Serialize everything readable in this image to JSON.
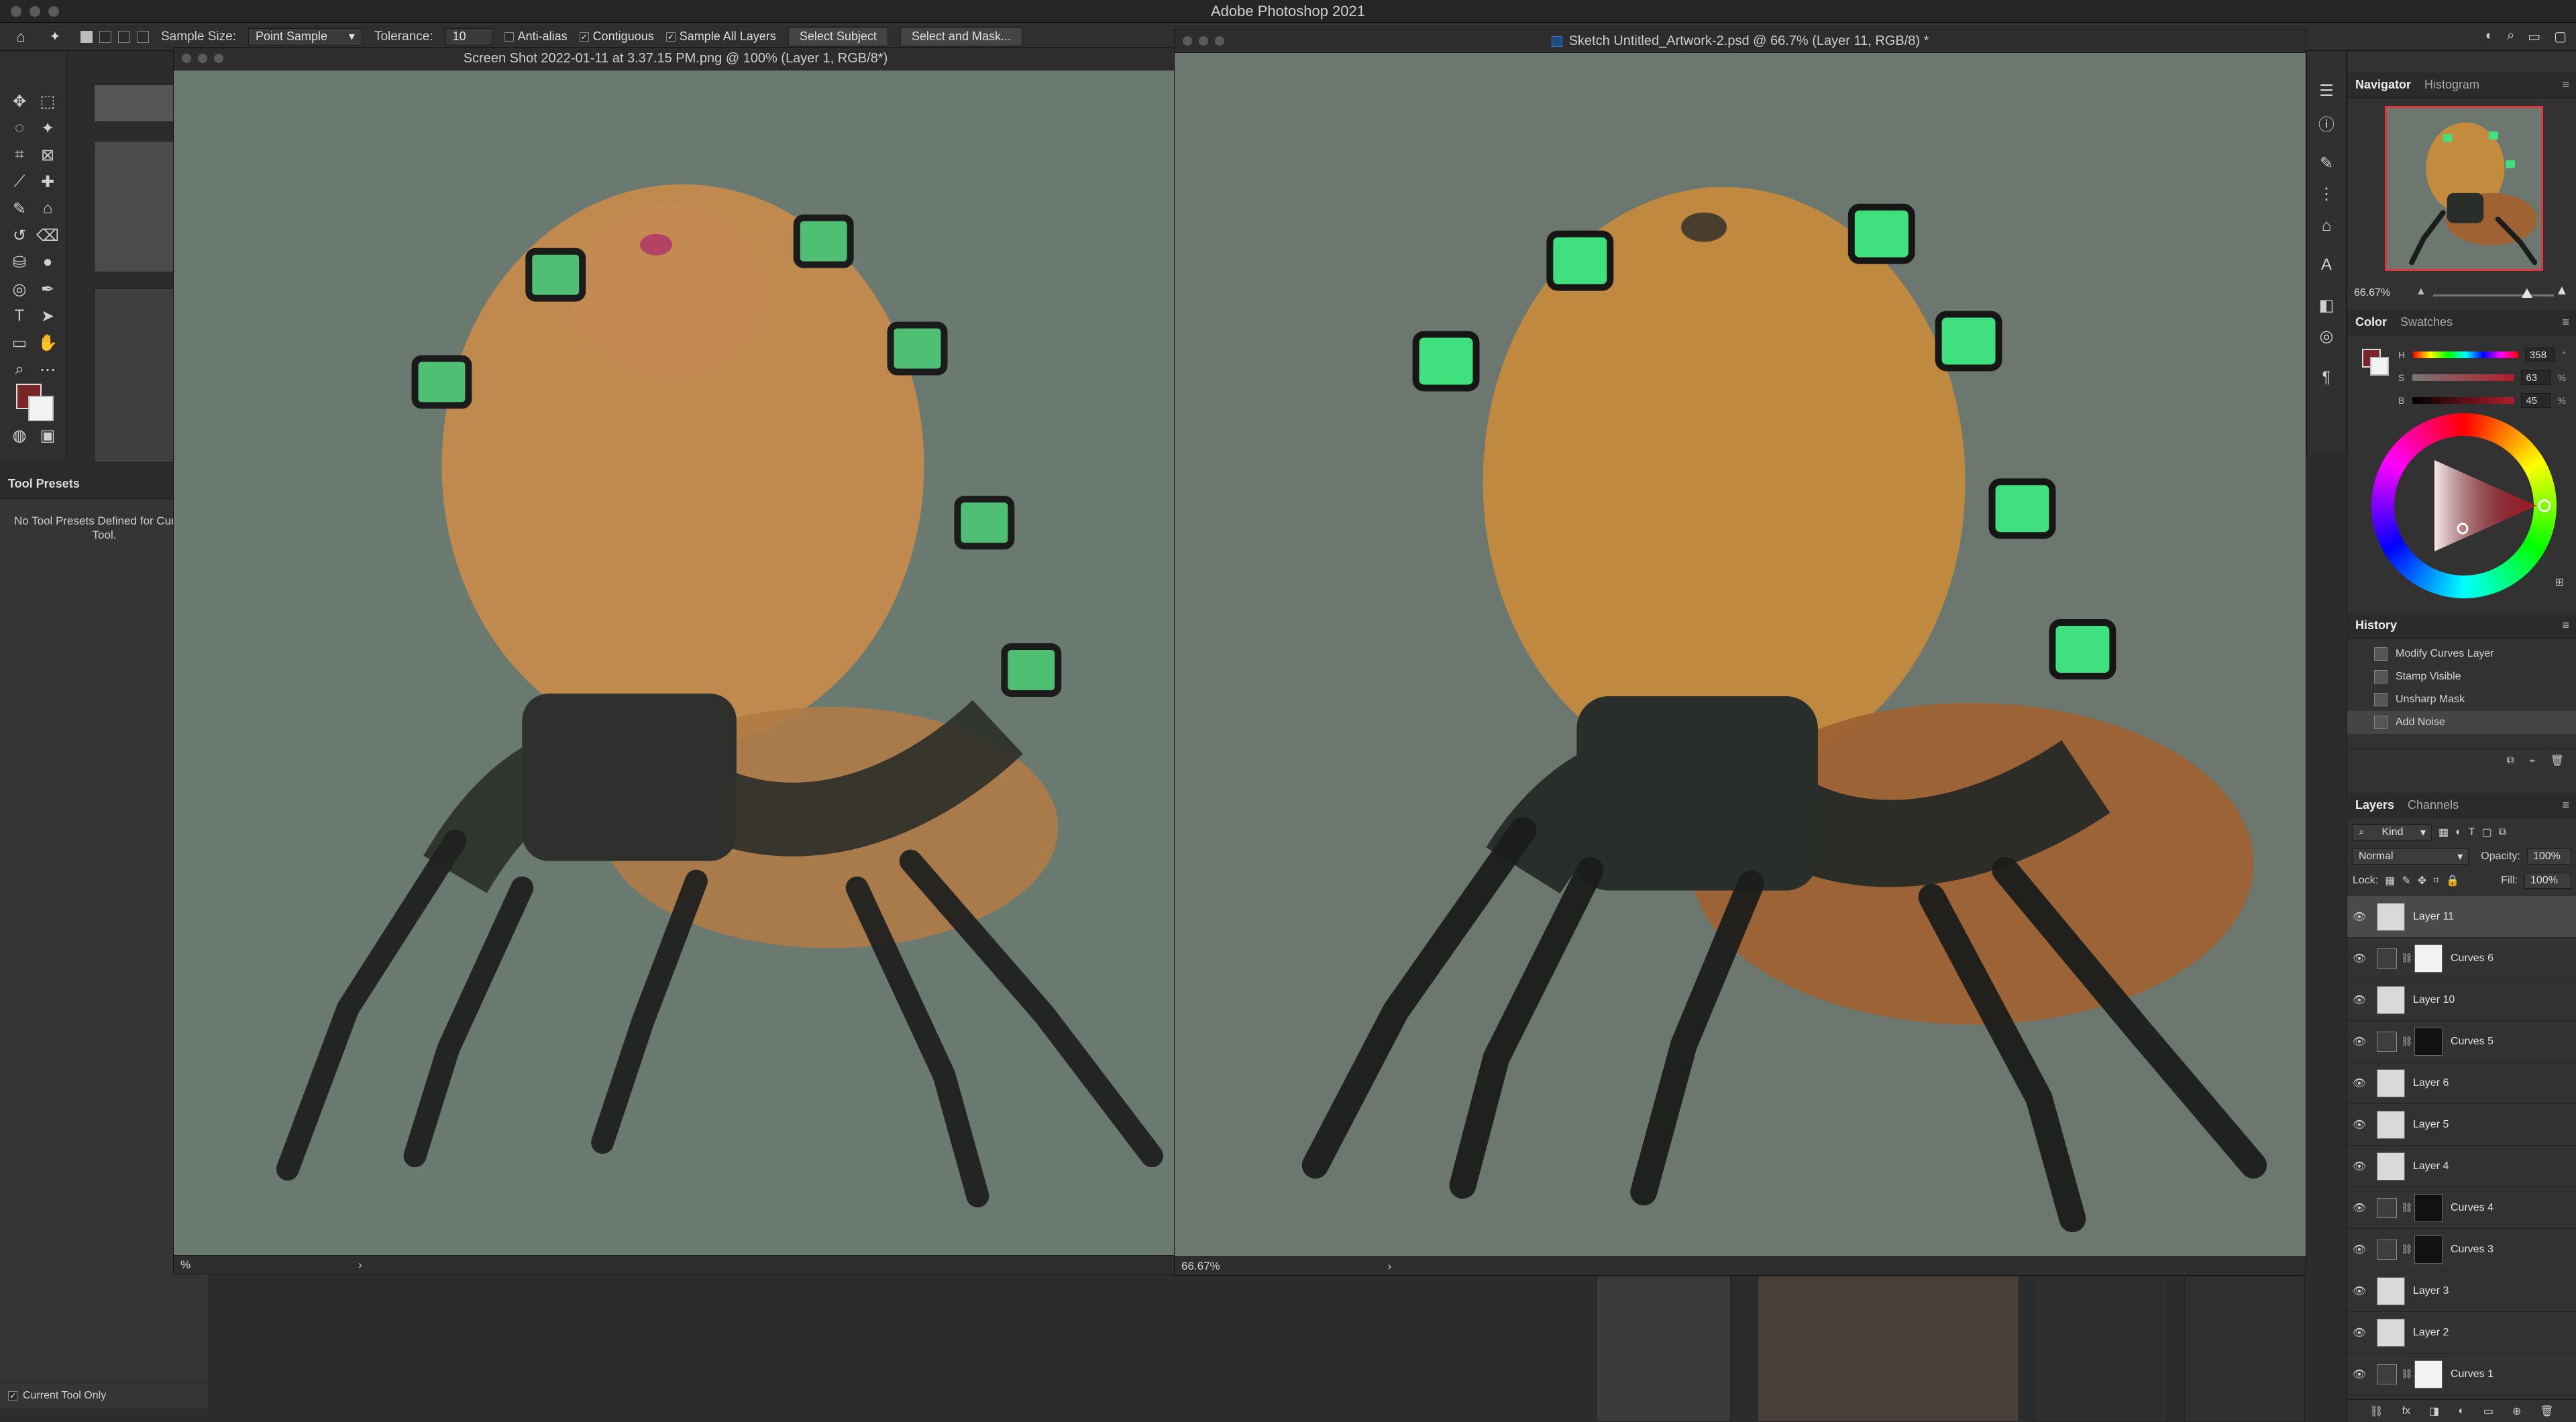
{
  "app": {
    "title": "Adobe Photoshop 2021"
  },
  "options_bar": {
    "sample_size_label": "Sample Size:",
    "sample_size_value": "Point Sample",
    "tolerance_label": "Tolerance:",
    "tolerance_value": "10",
    "anti_alias_label": "Anti-alias",
    "anti_alias_checked": false,
    "contiguous_label": "Contiguous",
    "contiguous_checked": true,
    "sample_all_layers_label": "Sample All Layers",
    "sample_all_layers_checked": true,
    "select_subject_label": "Select Subject",
    "select_and_mask_label": "Select and Mask..."
  },
  "documents": [
    {
      "title": "Screen Shot 2022-01-11 at 3.37.15 PM.png @ 100% (Layer 1, RGB/8*)",
      "status_zoom": "%"
    },
    {
      "title": "Sketch Untitled_Artwork-2.psd @ 66.7% (Layer 11, RGB/8) *",
      "status_zoom": "66.67%"
    }
  ],
  "tool_presets": {
    "title": "Tool Presets",
    "message": "No Tool Presets Defined for Current Tool.",
    "footer_label": "Current Tool Only"
  },
  "navigator": {
    "tabs": [
      "Navigator",
      "Histogram"
    ],
    "zoom": "66.67%",
    "zoom_fraction": 0.78
  },
  "color": {
    "tabs": [
      "Color",
      "Swatches"
    ],
    "foreground": "#7a2628",
    "background": "#f2f2f2",
    "h": "358",
    "s": "63",
    "b": "45",
    "h_unit": "°",
    "s_unit": "%",
    "b_unit": "%"
  },
  "history": {
    "title": "History",
    "items": [
      {
        "label": "Modify Curves Layer"
      },
      {
        "label": "Stamp Visible"
      },
      {
        "label": "Unsharp Mask"
      },
      {
        "label": "Add Noise",
        "selected": true
      }
    ]
  },
  "layers": {
    "tabs": [
      "Layers",
      "Channels"
    ],
    "kind_label": "Kind",
    "blend_mode": "Normal",
    "opacity_label": "Opacity:",
    "opacity_value": "100%",
    "lock_label": "Lock:",
    "fill_label": "Fill:",
    "fill_value": "100%",
    "items": [
      {
        "name": "Layer 11",
        "type": "pixel",
        "selected": true
      },
      {
        "name": "Curves 6",
        "type": "adjustment",
        "mask": "white"
      },
      {
        "name": "Layer 10",
        "type": "pixel"
      },
      {
        "name": "Curves 5",
        "type": "adjustment",
        "mask": "dark"
      },
      {
        "name": "Layer 6",
        "type": "pixel"
      },
      {
        "name": "Layer 5",
        "type": "pixel"
      },
      {
        "name": "Layer 4",
        "type": "pixel"
      },
      {
        "name": "Curves 4",
        "type": "adjustment",
        "mask": "dark"
      },
      {
        "name": "Curves 3",
        "type": "adjustment",
        "mask": "dark"
      },
      {
        "name": "Layer 3",
        "type": "pixel"
      },
      {
        "name": "Layer 2",
        "type": "pixel"
      },
      {
        "name": "Curves 1",
        "type": "adjustment",
        "mask": "white"
      }
    ]
  }
}
